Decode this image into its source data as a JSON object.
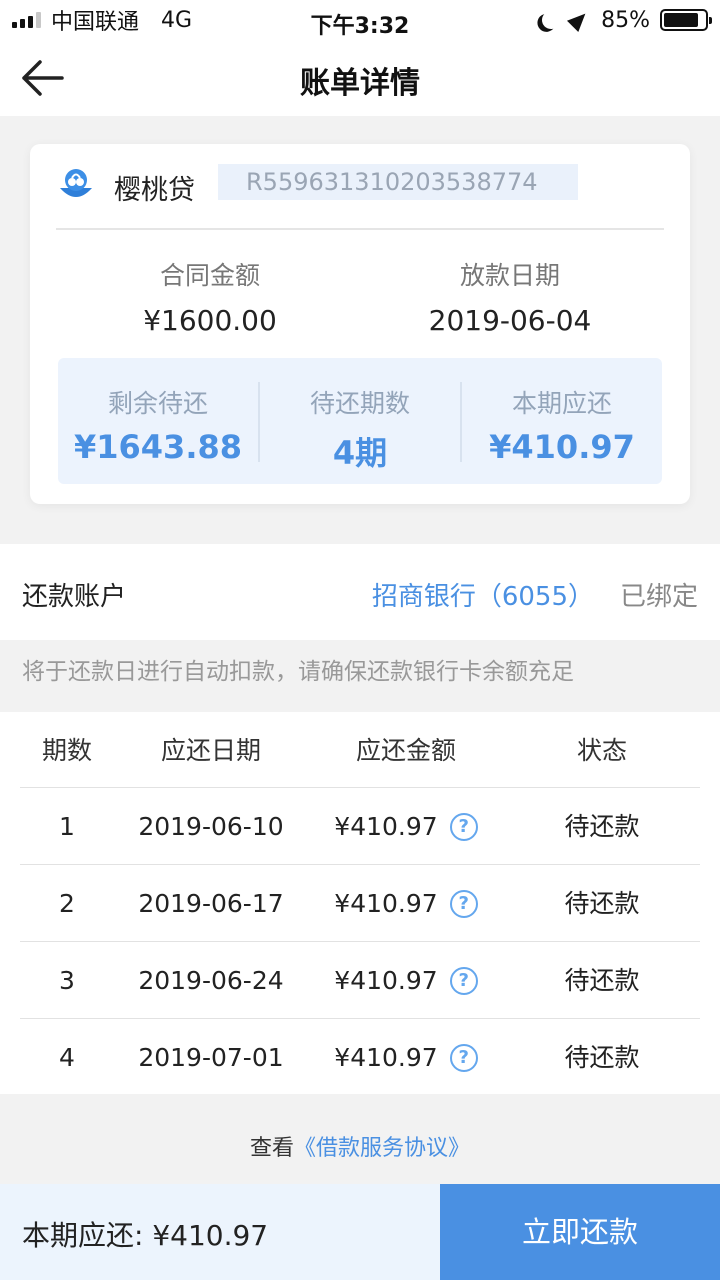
{
  "status_bar": {
    "carrier": "中国联通",
    "network": "4G",
    "time": "下午3:32",
    "battery": "85%",
    "battery_level": 0.85
  },
  "nav": {
    "title": "账单详情",
    "back_icon": "back-arrow-icon"
  },
  "loan": {
    "brand_name": "樱桃贷",
    "contract_no": "R559631310203538774",
    "contract_amount_label": "合同金额",
    "contract_amount": "¥1600.00",
    "disbursement_date_label": "放款日期",
    "disbursement_date": "2019-06-04",
    "stats": [
      {
        "label": "剩余待还",
        "value": "¥1643.88"
      },
      {
        "label": "待还期数",
        "value": "4期"
      },
      {
        "label": "本期应还",
        "value": "¥410.97"
      }
    ]
  },
  "account": {
    "label": "还款账户",
    "bank": "招商银行（6055）",
    "status": "已绑定"
  },
  "notice": "将于还款日进行自动扣款，请确保还款银行卡余额充足",
  "table": {
    "headers": [
      "期数",
      "应还日期",
      "应还金额",
      "状态"
    ],
    "rows": [
      {
        "period": "1",
        "date": "2019-06-10",
        "amount": "¥410.97",
        "status": "待还款"
      },
      {
        "period": "2",
        "date": "2019-06-17",
        "amount": "¥410.97",
        "status": "待还款"
      },
      {
        "period": "3",
        "date": "2019-06-24",
        "amount": "¥410.97",
        "status": "待还款"
      },
      {
        "period": "4",
        "date": "2019-07-01",
        "amount": "¥410.97",
        "status": "待还款"
      }
    ],
    "help_glyph": "?"
  },
  "agreement": {
    "prefix": "查看",
    "link": "《借款服务协议》"
  },
  "footer": {
    "due_text": "本期应还: ¥410.97",
    "pay_button": "立即还款"
  },
  "colors": {
    "accent": "#4a90e2",
    "stats_bg": "#ecf3fd",
    "page_bg": "#f2f2f2"
  }
}
